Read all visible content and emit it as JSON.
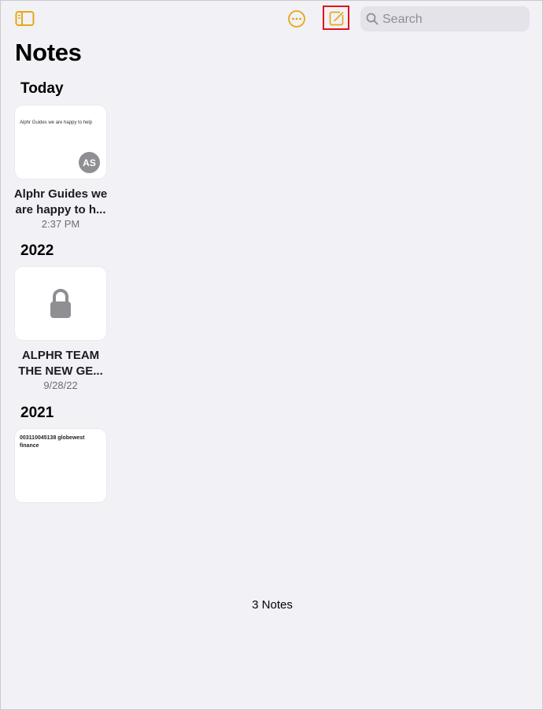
{
  "toolbar": {
    "sidebar_icon": "sidebar-icon",
    "more_icon": "ellipsis-circle-icon",
    "compose_icon": "compose-icon",
    "search_placeholder": "Search",
    "accent_color": "#e6a817",
    "highlight_color": "#e0141c"
  },
  "page": {
    "title": "Notes"
  },
  "sections": [
    {
      "label": "Today",
      "notes": [
        {
          "preview": "Alphr Guides we  are happy to help",
          "avatar": "AS",
          "title_line1": "Alphr Guides we",
          "title_line2": "are happy to h...",
          "date": "2:37 PM"
        }
      ]
    },
    {
      "label": "2022",
      "notes": [
        {
          "locked": true,
          "lock_icon": "lock-icon",
          "title_line1": "ALPHR TEAM",
          "title_line2": "THE NEW GE...",
          "date": "9/28/22"
        }
      ]
    },
    {
      "label": "2021",
      "notes": [
        {
          "preview": "003110045138 globewest finance"
        }
      ]
    }
  ],
  "footer": {
    "count": "3 Notes"
  }
}
